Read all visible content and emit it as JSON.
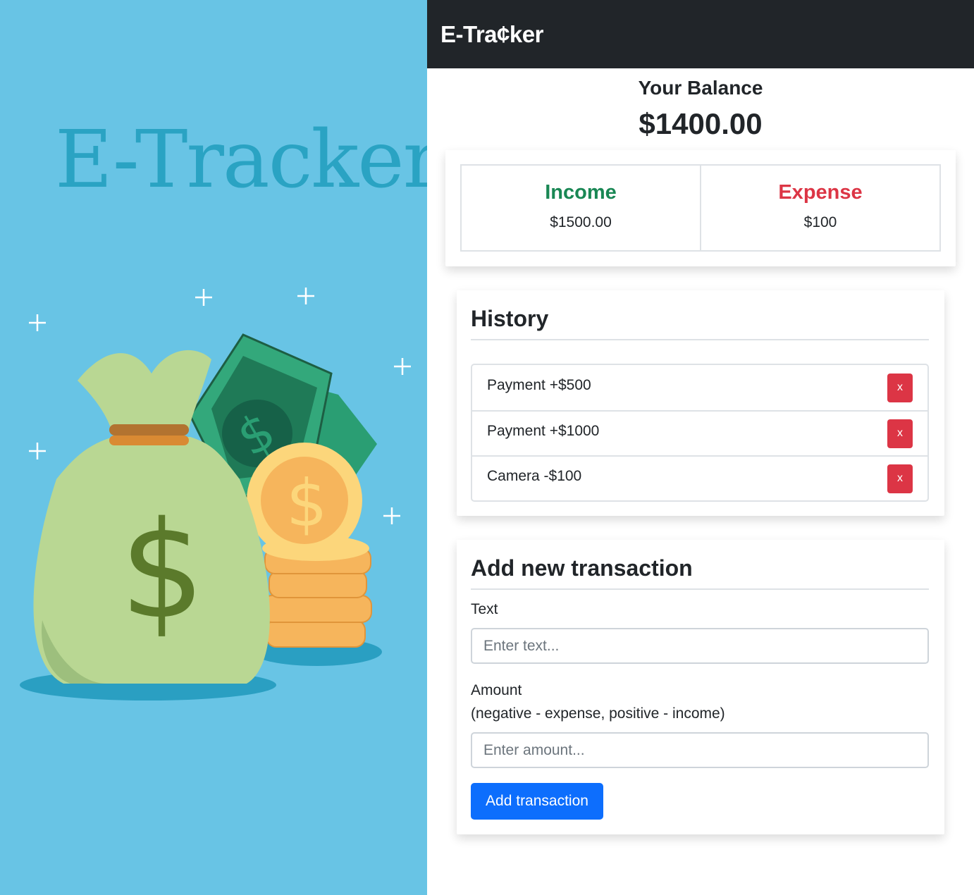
{
  "hero": {
    "title": "E-Tracker",
    "illustration": "money-bag-with-banknotes-and-coins"
  },
  "navbar": {
    "brand": "E-Tra¢ker"
  },
  "balance": {
    "label": "Your Balance",
    "value": "$1400.00"
  },
  "summary": {
    "income": {
      "label": "Income",
      "amount": "$1500.00",
      "color": "#198754"
    },
    "expense": {
      "label": "Expense",
      "amount": "$100",
      "color": "#dc3545"
    }
  },
  "history": {
    "title": "History",
    "items": [
      {
        "text": "Payment +$500",
        "delete_label": "x"
      },
      {
        "text": "Payment +$1000",
        "delete_label": "x"
      },
      {
        "text": "Camera -$100",
        "delete_label": "x"
      }
    ]
  },
  "add_transaction": {
    "title": "Add new transaction",
    "text_label": "Text",
    "text_placeholder": "Enter text...",
    "text_value": "",
    "amount_label": "Amount",
    "amount_hint": "(negative - expense, positive - income)",
    "amount_placeholder": "Enter amount...",
    "amount_value": "",
    "submit_label": "Add transaction"
  },
  "colors": {
    "hero_background": "#68c4e5",
    "hero_title": "#2aa3c3",
    "navbar": "#212529",
    "primary": "#0d6efd",
    "danger": "#dc3545",
    "success": "#198754"
  }
}
